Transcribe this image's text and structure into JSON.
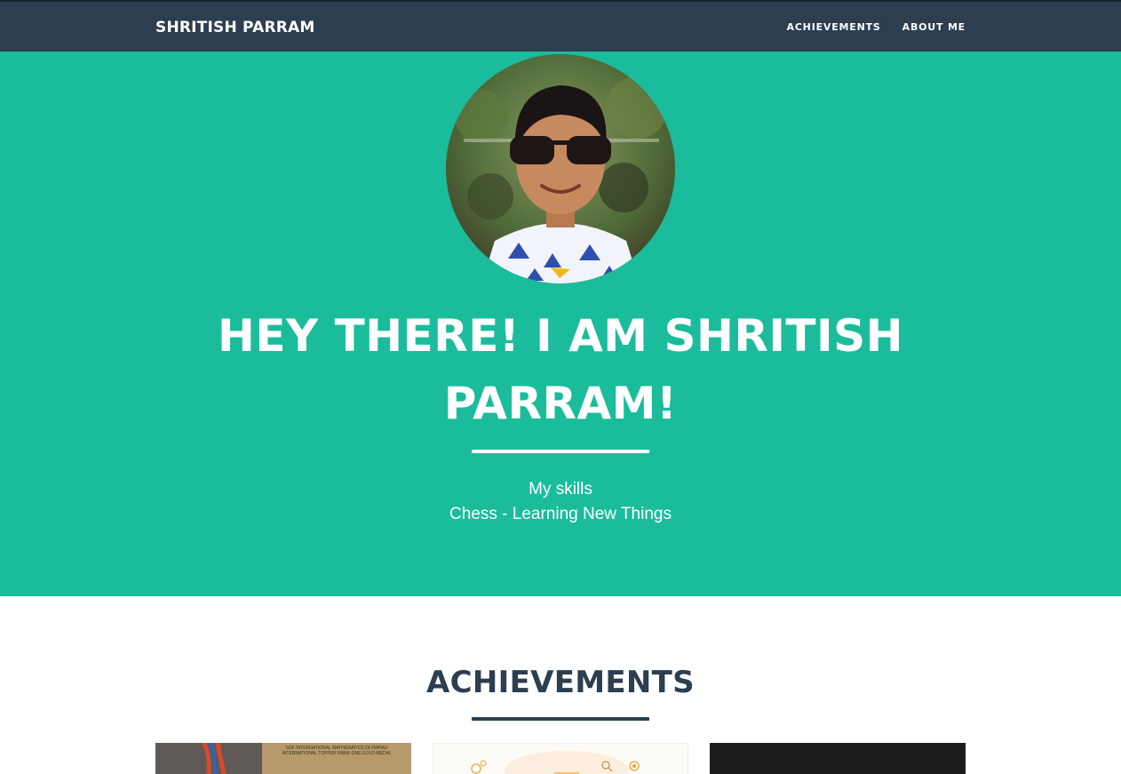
{
  "nav": {
    "brand": "SHRITISH PARRAM",
    "links": [
      {
        "label": "ACHIEVEMENTS"
      },
      {
        "label": "ABOUT ME"
      }
    ]
  },
  "hero": {
    "title": "HEY THERE! I AM SHRITISH PARRAM!",
    "skills_heading": "My skills",
    "skills_list": "Chess - Learning New Things"
  },
  "achievements": {
    "title": "ACHIEVEMENTS",
    "card1_line1": "SOF INTERNATIONAL MATHEMATICS OLYMPIAD",
    "card1_line2": "INTERNATIONAL TOPPER RANK-ONE GOLD MEDAL"
  },
  "colors": {
    "navbar": "#2c3e50",
    "hero_bg": "#1abc9c",
    "text_dark": "#2c3e50",
    "text_light": "#ffffff"
  }
}
